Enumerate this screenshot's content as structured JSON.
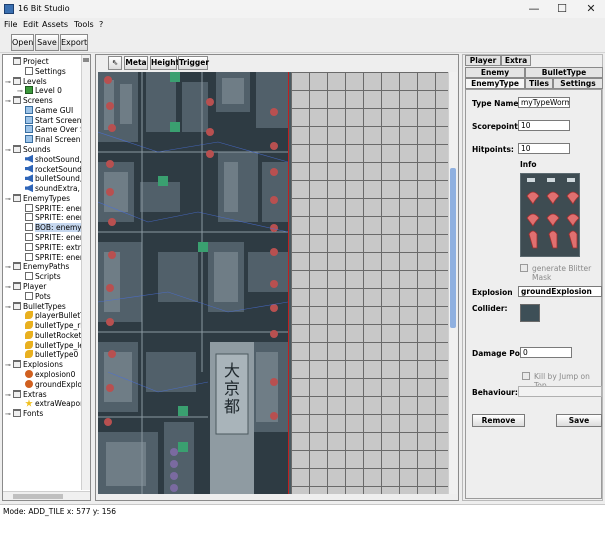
{
  "window": {
    "title": "16 Bit Studio",
    "minimize": "—",
    "maximize": "☐",
    "close": "✕"
  },
  "menu": [
    "File",
    "Edit",
    "Assets",
    "Tools",
    "?"
  ],
  "toolbar": {
    "open": "Open",
    "save": "Save",
    "export": "Export"
  },
  "tree": [
    {
      "label": "Project",
      "icon": "folder",
      "level": 0,
      "handle": ""
    },
    {
      "label": "Settings",
      "icon": "page",
      "level": 1,
      "handle": ""
    },
    {
      "label": "Levels",
      "icon": "folder",
      "level": 0,
      "handle": "⊸"
    },
    {
      "label": "Level 0",
      "icon": "level",
      "level": 1,
      "handle": "⊸"
    },
    {
      "label": "Screens",
      "icon": "folder",
      "level": 0,
      "handle": "⊸"
    },
    {
      "label": "Game GUI",
      "icon": "screen",
      "level": 1,
      "handle": ""
    },
    {
      "label": "Start Screen",
      "icon": "screen",
      "level": 1,
      "handle": ""
    },
    {
      "label": "Game Over Scre",
      "icon": "screen",
      "level": 1,
      "handle": ""
    },
    {
      "label": "Final Screen",
      "icon": "screen",
      "level": 1,
      "handle": ""
    },
    {
      "label": "Sounds",
      "icon": "folder",
      "level": 0,
      "handle": "⊸"
    },
    {
      "label": "shootSound, P:",
      "icon": "sound",
      "level": 1,
      "handle": ""
    },
    {
      "label": "rocketSound, P:",
      "icon": "sound",
      "level": 1,
      "handle": ""
    },
    {
      "label": "bulletSound, P:",
      "icon": "sound",
      "level": 1,
      "handle": ""
    },
    {
      "label": "soundExtra, P: C",
      "icon": "sound",
      "level": 1,
      "handle": ""
    },
    {
      "label": "EnemyTypes",
      "icon": "folder",
      "level": 0,
      "handle": "⊸"
    },
    {
      "label": "SPRITE: enemy",
      "icon": "page",
      "level": 1,
      "handle": ""
    },
    {
      "label": "SPRITE: enemy",
      "icon": "page",
      "level": 1,
      "handle": ""
    },
    {
      "label": "BOB: enemyTyp",
      "icon": "page",
      "level": 1,
      "handle": "",
      "selected": true
    },
    {
      "label": "SPRITE: enemy",
      "icon": "page",
      "level": 1,
      "handle": ""
    },
    {
      "label": "SPRITE: extraTy",
      "icon": "page",
      "level": 1,
      "handle": ""
    },
    {
      "label": "SPRITE: enemy",
      "icon": "page",
      "level": 1,
      "handle": ""
    },
    {
      "label": "EnemyPaths",
      "icon": "folder",
      "level": 0,
      "handle": "⊸"
    },
    {
      "label": "Scripts",
      "icon": "page",
      "level": 1,
      "handle": ""
    },
    {
      "label": "Player",
      "icon": "folder",
      "level": 0,
      "handle": "⊸"
    },
    {
      "label": "Pots",
      "icon": "page",
      "level": 1,
      "handle": ""
    },
    {
      "label": "BulletTypes",
      "icon": "folder",
      "level": 0,
      "handle": "⊸"
    },
    {
      "label": "playerBulletType",
      "icon": "bullet",
      "level": 1,
      "handle": ""
    },
    {
      "label": "bulletType_right",
      "icon": "bullet",
      "level": 1,
      "handle": ""
    },
    {
      "label": "bulletRocket0",
      "icon": "bullet",
      "level": 1,
      "handle": ""
    },
    {
      "label": "bulletType_left_",
      "icon": "bullet",
      "level": 1,
      "handle": ""
    },
    {
      "label": "bulletType0",
      "icon": "bullet",
      "level": 1,
      "handle": ""
    },
    {
      "label": "Explosions",
      "icon": "folder",
      "level": 0,
      "handle": "⊸"
    },
    {
      "label": "explosion0",
      "icon": "explo",
      "level": 1,
      "handle": ""
    },
    {
      "label": "groundExplosio",
      "icon": "explo",
      "level": 1,
      "handle": ""
    },
    {
      "label": "Extras",
      "icon": "folder",
      "level": 0,
      "handle": "⊸"
    },
    {
      "label": "extraWeapon",
      "icon": "star",
      "level": 1,
      "handle": ""
    },
    {
      "label": "Fonts",
      "icon": "folder",
      "level": 0,
      "handle": "⊸"
    }
  ],
  "editor_toolbar": {
    "pointer": "⇖",
    "meta": "Meta",
    "height": "Height",
    "trigger": "Trigger"
  },
  "map_sign": {
    "line1": "大",
    "line2": "京",
    "line3": "都"
  },
  "tabs": {
    "row1": [
      "Player",
      "Extra"
    ],
    "row2": [
      "Enemy",
      "BulletType"
    ],
    "row3": [
      "EnemyType",
      "Tiles",
      "Settings"
    ]
  },
  "form": {
    "type_name_label": "Type Name:",
    "type_name_value": "myTypeWorm0",
    "scorepoints_label": "Scorepoints",
    "scorepoints_value": "10",
    "hitpoints_label": "Hitpoints:",
    "hitpoints_value": "10",
    "info_label": "Info",
    "blitter_mask_label": "generate Blitter Mask",
    "explosion_label": "Explosion",
    "explosion_value": "groundExplosion",
    "collider_label": "Collider:",
    "collider_color": "#3d4f57",
    "damage_label": "Damage Po...",
    "damage_value": "0",
    "kill_jump_label": "Kill by Jump on Top",
    "behaviour_label": "Behaviour:",
    "behaviour_value": "",
    "remove": "Remove",
    "save": "Save"
  },
  "status": "Mode: ADD_TILE x: 577 y: 156"
}
